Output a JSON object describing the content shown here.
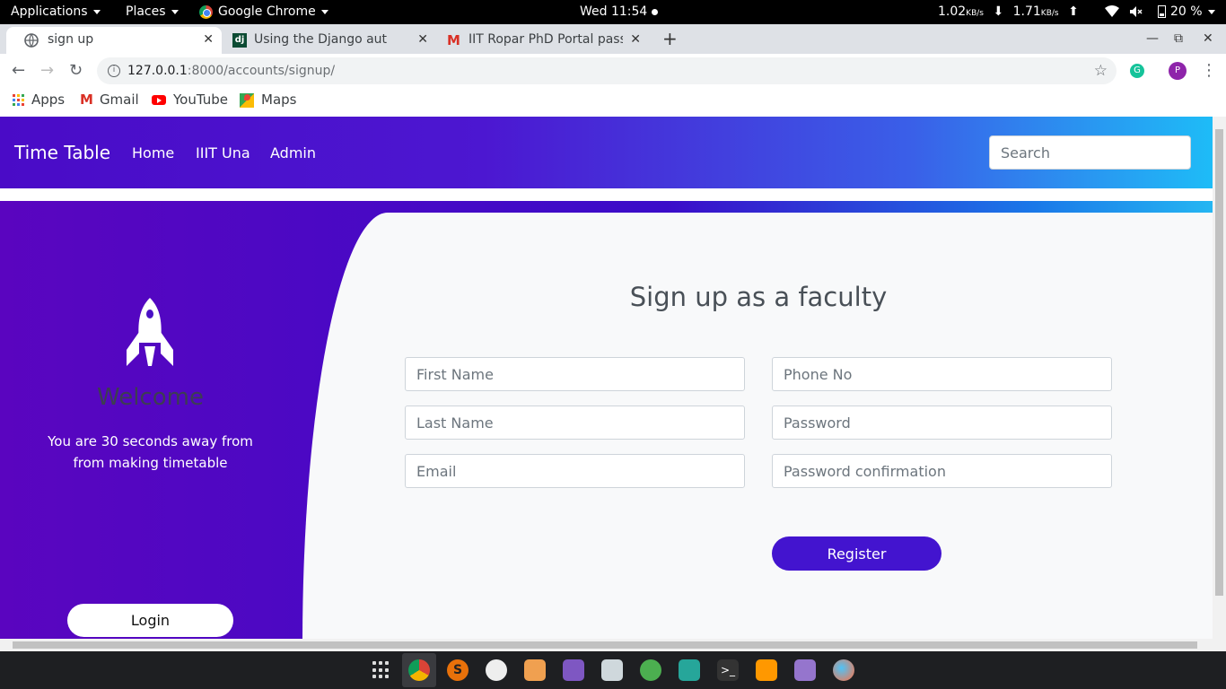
{
  "system_bar": {
    "applications": "Applications",
    "places": "Places",
    "chrome_app": "Google Chrome",
    "clock": "Wed 11:54",
    "net_down": "1.02",
    "net_down_unit": "KB/s",
    "net_up": "1.71",
    "net_up_unit": "KB/s",
    "battery": "20 %"
  },
  "tabs": [
    {
      "title": "sign up"
    },
    {
      "title": "Using the Django authenti"
    },
    {
      "title": "IIT Ropar PhD Portal passw"
    }
  ],
  "address": {
    "host": "127.0.0.1",
    "path": ":8000/accounts/signup/"
  },
  "profile_initial": "P",
  "bookmarks": [
    "Apps",
    "Gmail",
    "YouTube",
    "Maps"
  ],
  "navbar": {
    "brand": "Time Table",
    "links": [
      "Home",
      "IIIT Una",
      "Admin"
    ],
    "search_placeholder": "Search"
  },
  "left_panel": {
    "welcome": "Welcome",
    "tagline": "You are 30 seconds away from from making timetable",
    "login_label": "Login"
  },
  "form": {
    "title": "Sign up as a faculty",
    "first_name": "First Name",
    "last_name": "Last Name",
    "email": "Email",
    "phone": "Phone No",
    "password": "Password",
    "password_confirm": "Password confirmation",
    "register_label": "Register"
  },
  "colors": {
    "navbar_start": "#4a0bc7",
    "navbar_end": "#1ebcf7",
    "register_button": "#4314cf",
    "form_background": "#f8f9fa"
  }
}
